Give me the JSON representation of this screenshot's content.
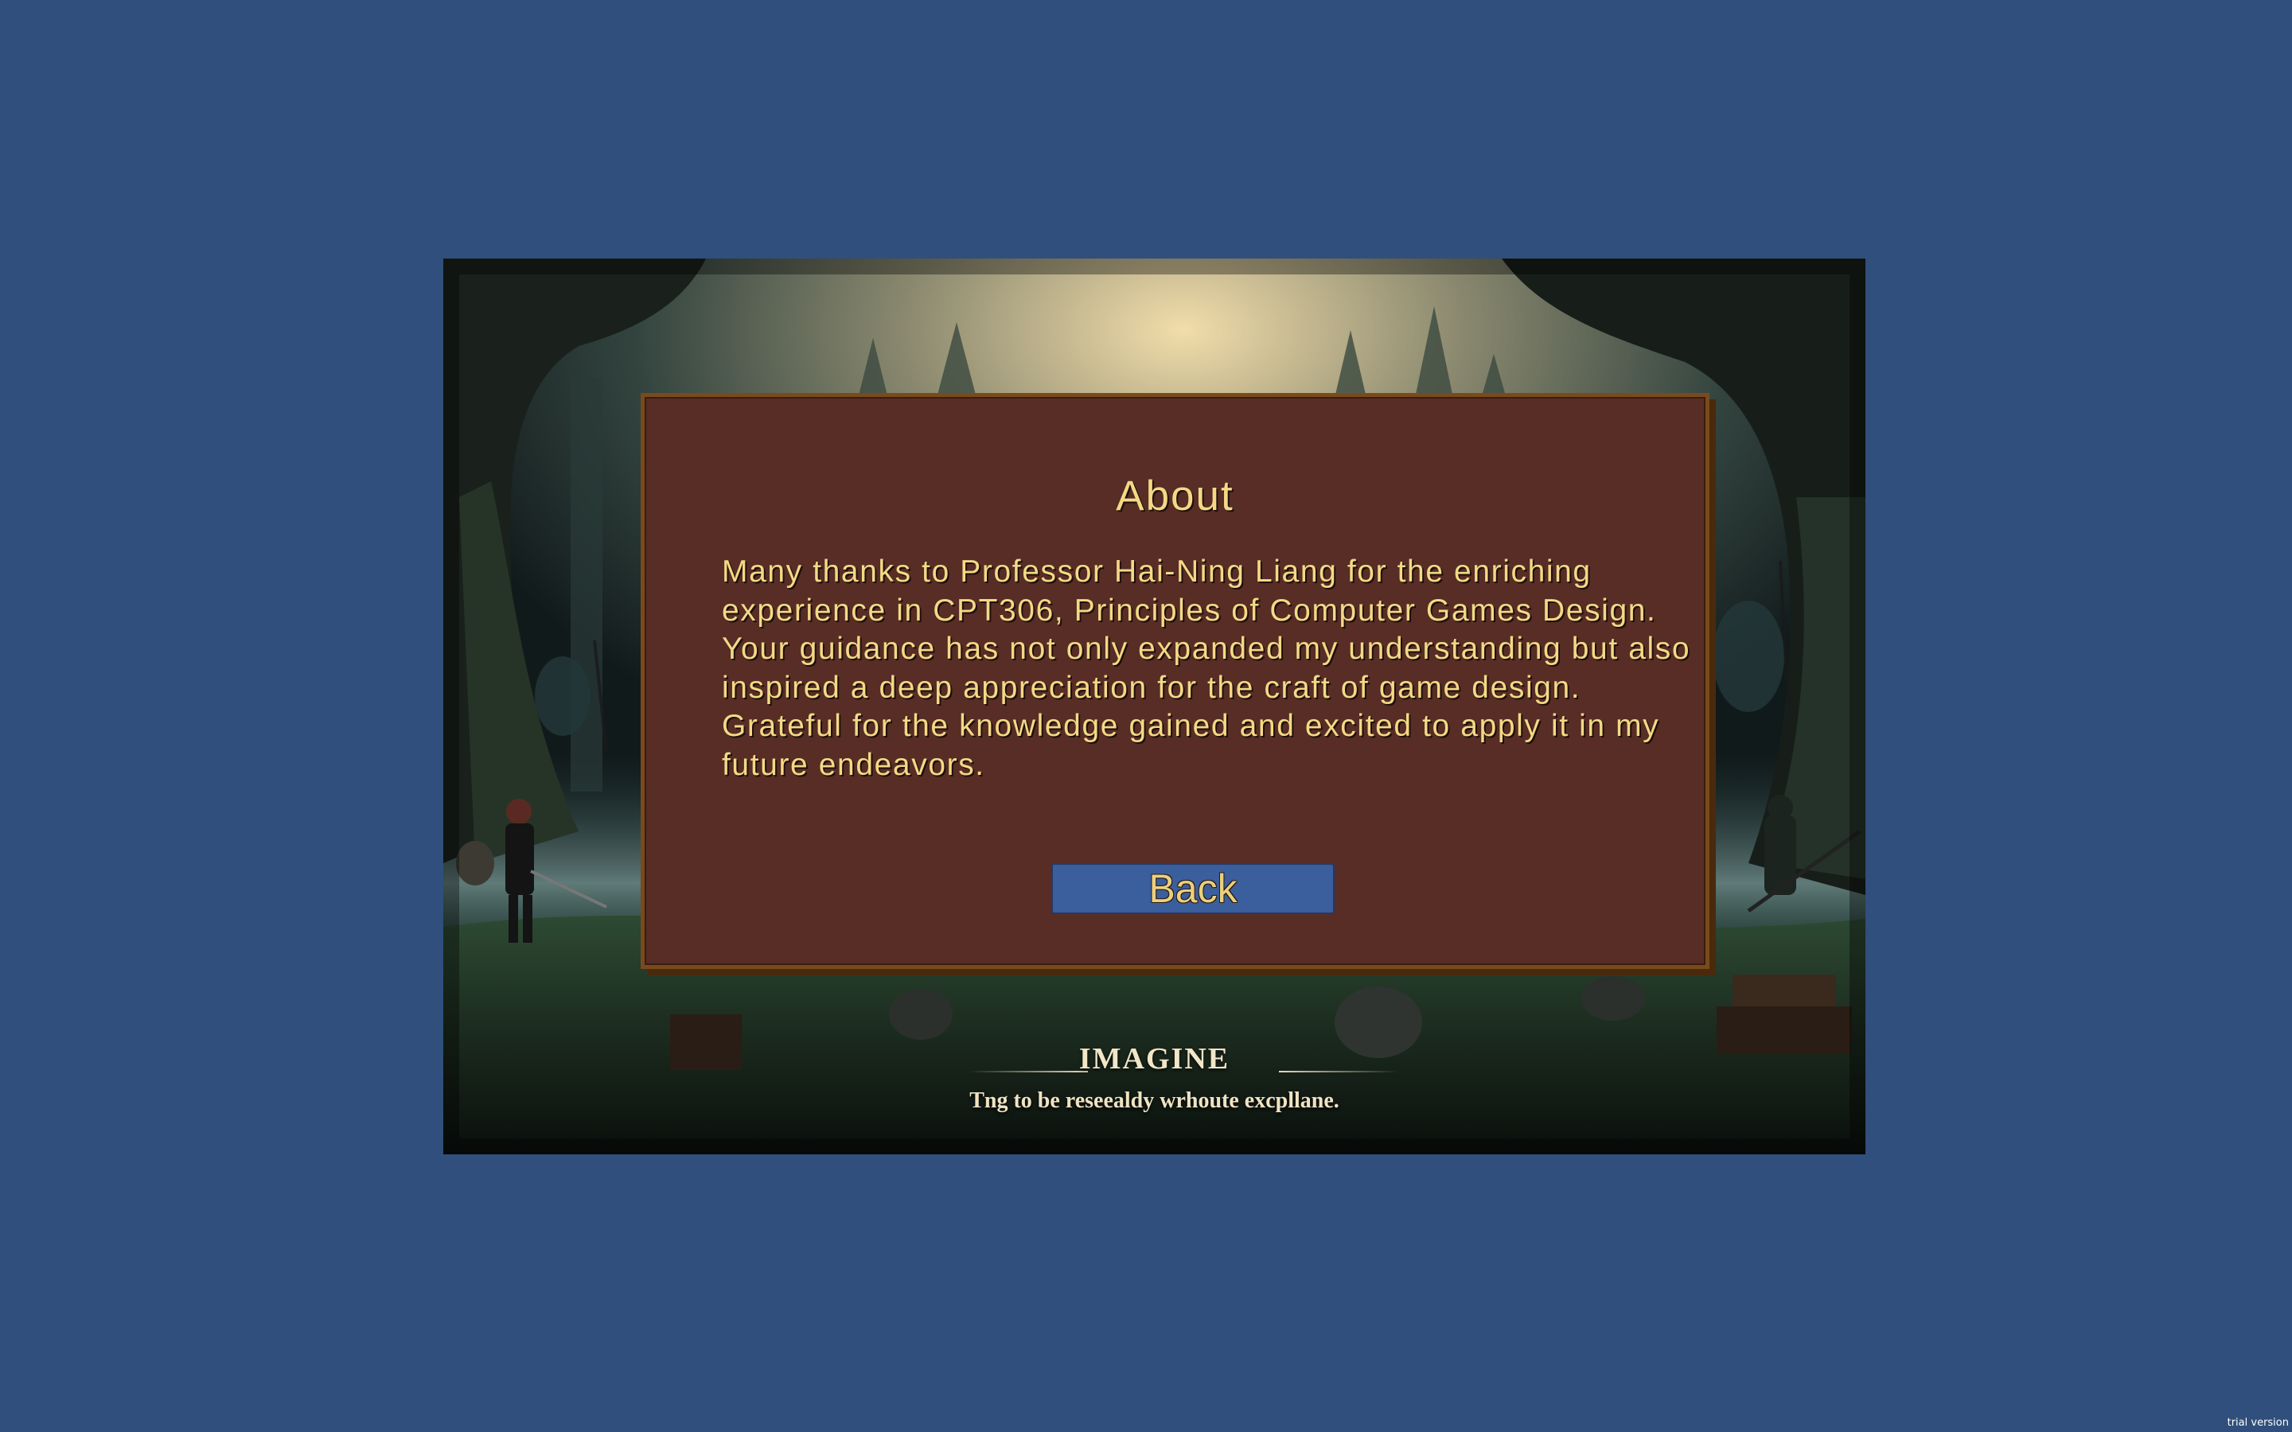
{
  "background": {
    "color": "#304f7c",
    "game_title": "IMAGINE",
    "tagline": "Tng to be reseealdy wrhoute excpllane."
  },
  "dialog": {
    "title": "About",
    "body": "Many thanks to Professor Hai-Ning Liang for the enriching experience in CPT306, Principles of Computer Games Design. Your guidance has not only expanded my understanding but also inspired a deep appreciation for the craft of game design. Grateful for the knowledge gained and excited to apply it in my future endeavors.",
    "back_label": "Back",
    "panel_color": "#572d26",
    "text_color": "#f3d985",
    "button_color": "#3b5e9c"
  },
  "watermark": "trial version",
  "icons": {
    "characters": [
      "warrior-figure",
      "spear-figure",
      "archer-figure",
      "shadow-creature"
    ]
  }
}
